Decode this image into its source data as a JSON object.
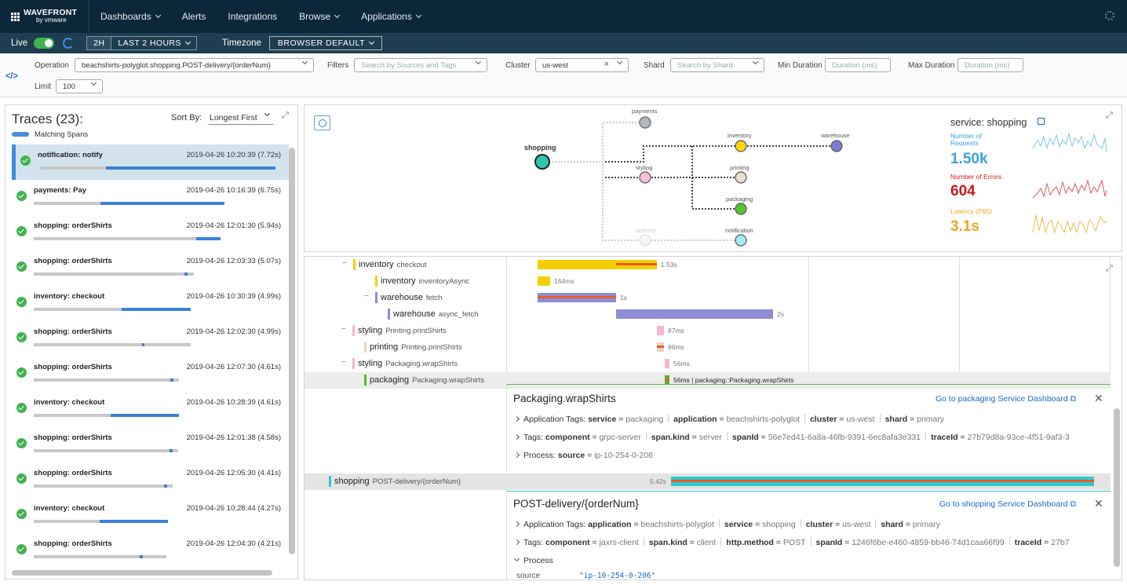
{
  "nav": {
    "logo_line1": "WAVEFRONT",
    "logo_line2": "by vmware",
    "items": [
      "Dashboards",
      "Alerts",
      "Integrations",
      "Browse",
      "Applications"
    ],
    "has_caret": [
      true,
      false,
      false,
      true,
      true
    ]
  },
  "timebar": {
    "live_label": "Live",
    "range_short": "2H",
    "range_long": "LAST 2 HOURS",
    "timezone_label": "Timezone",
    "timezone_value": "BROWSER DEFAULT"
  },
  "filters": {
    "operation_label": "Operation",
    "operation_value": "beachshirts-polyglot.shopping.POST-delivery/{orderNum}",
    "filters_label": "Filters",
    "filters_placeholder": "Search by Sources and Tags",
    "cluster_label": "Cluster",
    "cluster_value": "us-west",
    "shard_label": "Shard",
    "shard_placeholder": "Search by Shard",
    "min_label": "Min Duration",
    "min_placeholder": "Duration (ms)",
    "max_label": "Max Duration",
    "max_placeholder": "Duration (ms)",
    "limit_label": "Limit",
    "limit_value": "100"
  },
  "traces": {
    "title": "Traces (23):",
    "sort_label": "Sort By:",
    "sort_value": "Longest First",
    "legend": "Matching Spans",
    "items": [
      {
        "name": "notification: notify",
        "date": "2019-04-26 10:20:39 (7.72s)",
        "track_w": 300,
        "fill_start": 0.28,
        "fill_w": 0.72
      },
      {
        "name": "payments: Pay",
        "date": "2019-04-26 10:16:39 (6.75s)",
        "track_w": 243,
        "fill_start": 0.35,
        "fill_w": 0.65
      },
      {
        "name": "shopping: orderShirts",
        "date": "2019-04-26 12:01:30 (5.94s)",
        "track_w": 238,
        "fill_start": 0.87,
        "fill_w": 0.13
      },
      {
        "name": "shopping: orderShirts",
        "date": "2019-04-26 12:03:33 (5.07s)",
        "track_w": 204,
        "fill_start": 0.94,
        "fill_w": 0.02
      },
      {
        "name": "inventory: checkout",
        "date": "2019-04-26 10:30:39 (4.99s)",
        "track_w": 200,
        "fill_start": 0.56,
        "fill_w": 0.44
      },
      {
        "name": "shopping: orderShirts",
        "date": "2019-04-26 12:02:30 (4.99s)",
        "track_w": 200,
        "fill_start": 0.69,
        "fill_w": 0.01
      },
      {
        "name": "shopping: orderShirts",
        "date": "2019-04-26 12:07:30 (4.61s)",
        "track_w": 185,
        "fill_start": 0.94,
        "fill_w": 0.02
      },
      {
        "name": "inventory: checkout",
        "date": "2019-04-26 10:28:39 (4.61s)",
        "track_w": 185,
        "fill_start": 0.53,
        "fill_w": 0.47
      },
      {
        "name": "shopping: orderShirts",
        "date": "2019-04-26 12:01:38 (4.58s)",
        "track_w": 184,
        "fill_start": 0.94,
        "fill_w": 0.02
      },
      {
        "name": "shopping: orderShirts",
        "date": "2019-04-26 12:05:30 (4.41s)",
        "track_w": 177,
        "fill_start": 0.94,
        "fill_w": 0.02
      },
      {
        "name": "inventory: checkout",
        "date": "2019-04-26 10:28:44 (4.27s)",
        "track_w": 171,
        "fill_start": 0.49,
        "fill_w": 0.51
      },
      {
        "name": "shopping: orderShirts",
        "date": "2019-04-26 12:04:30 (4.21s)",
        "track_w": 169,
        "fill_start": 0.8,
        "fill_w": 0.02
      }
    ]
  },
  "graph": {
    "nodes": [
      "payments",
      "shopping",
      "inventory",
      "warehouse",
      "styling",
      "printing",
      "packaging",
      "delivery",
      "notification"
    ],
    "service_title": "service: shopping",
    "requests_label_1": "Number of",
    "requests_label_2": "Requests",
    "requests_value": "1.50k",
    "errors_label": "Number of Errors",
    "errors_value": "604",
    "latency_label": "Latency (P95)",
    "latency_value": "3.1s",
    "colors": {
      "requests": "#3aa4dc",
      "errors": "#cc1a1a",
      "latency": "#f0a321"
    }
  },
  "spans": [
    {
      "svc": "inventory",
      "op": "checkout",
      "dur": "1.53s",
      "color": "#f5d000"
    },
    {
      "svc": "inventory",
      "op": "inventoryAsync",
      "dur": "164ms",
      "color": "#f5d000"
    },
    {
      "svc": "warehouse",
      "op": "fetch",
      "dur": "1s",
      "color": "#8f8cd6"
    },
    {
      "svc": "warehouse",
      "op": "async_fetch",
      "dur": "2s",
      "color": "#8f8cd6"
    },
    {
      "svc": "styling",
      "op": "Printing.printShirts",
      "dur": "87ms",
      "color": "#f7b4d1"
    },
    {
      "svc": "printing",
      "op": "Printing.printShirts",
      "dur": "86ms",
      "color": "#e8d5c5"
    },
    {
      "svc": "styling",
      "op": "Packaging.wrapShirts",
      "dur": "56ms",
      "color": "#f7b4d1"
    },
    {
      "svc": "packaging",
      "op": "Packaging.wrapShirts",
      "dur": "56ms | packaging::Packaging.wrapShirts",
      "color": "#4cb82f"
    }
  ],
  "detail1": {
    "title": "Packaging.wrapShirts",
    "link": "Go to packaging Service Dashboard",
    "app_tags_label": "Application Tags:",
    "app_tags": [
      [
        "service",
        "packaging"
      ],
      [
        "application",
        "beachshirts-polyglot"
      ],
      [
        "cluster",
        "us-west"
      ],
      [
        "shard",
        "primary"
      ]
    ],
    "tags_label": "Tags:",
    "tags": [
      [
        "component",
        "grpc-server"
      ],
      [
        "span.kind",
        "server"
      ],
      [
        "spanId",
        "56e7ed41-6a8a-46fb-9391-6ec8afa3e331"
      ],
      [
        "traceId",
        "27b79d8a-93ce-4f51-9af3-3"
      ]
    ],
    "process_label": "Process:",
    "process": [
      [
        "source",
        "ip-10-254-0-206"
      ]
    ]
  },
  "root_span": {
    "svc": "shopping",
    "op": "POST-delivery/{orderNum}",
    "dur": "5.42s",
    "color": "#2ecad0"
  },
  "detail2": {
    "title": "POST-delivery/{orderNum}",
    "link": "Go to shopping Service Dashboard",
    "app_tags_label": "Application Tags:",
    "app_tags": [
      [
        "application",
        "beachshirts-polyglot"
      ],
      [
        "service",
        "shopping"
      ],
      [
        "cluster",
        "us-west"
      ],
      [
        "shard",
        "primary"
      ]
    ],
    "tags_label": "Tags:",
    "tags": [
      [
        "component",
        "jaxrs-client"
      ],
      [
        "span.kind",
        "client"
      ],
      [
        "http.method",
        "POST"
      ],
      [
        "spanId",
        "1246f6be-e460-4859-bb46-74d1caa66f99"
      ],
      [
        "traceId",
        "27b7"
      ]
    ],
    "process_label": "Process",
    "process_key": "source",
    "process_val": "\"ip-10-254-0-206\""
  }
}
